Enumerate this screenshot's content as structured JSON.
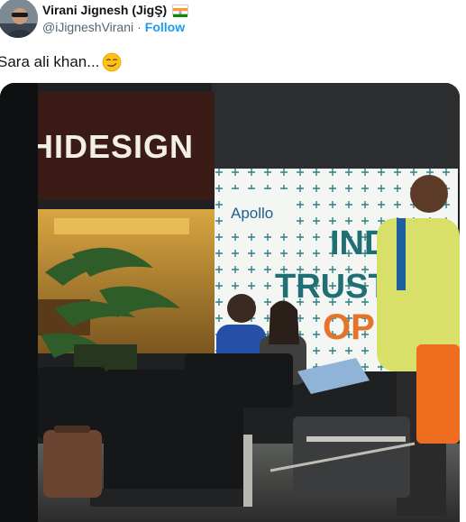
{
  "author": {
    "display_name": "Virani Jignesh (JigŞ)",
    "handle": "@iJigneshVirani",
    "separator": "·",
    "follow_label": "Follow"
  },
  "tweet": {
    "text": "Sara ali khan..."
  },
  "photo": {
    "signs": {
      "store": "HIDESIGN",
      "brand": "Apollo",
      "banner_line1": "INDI",
      "banner_line2": "TRUSTI",
      "banner_line3": "OPE"
    }
  },
  "icons": {
    "flag": "india-flag-icon",
    "emoji": "smirking-face-icon"
  },
  "colors": {
    "follow": "#1d9bf0",
    "handle": "#536471",
    "text": "#0f1419",
    "banner_teal": "#1f6f74",
    "banner_orange": "#e5742b"
  }
}
